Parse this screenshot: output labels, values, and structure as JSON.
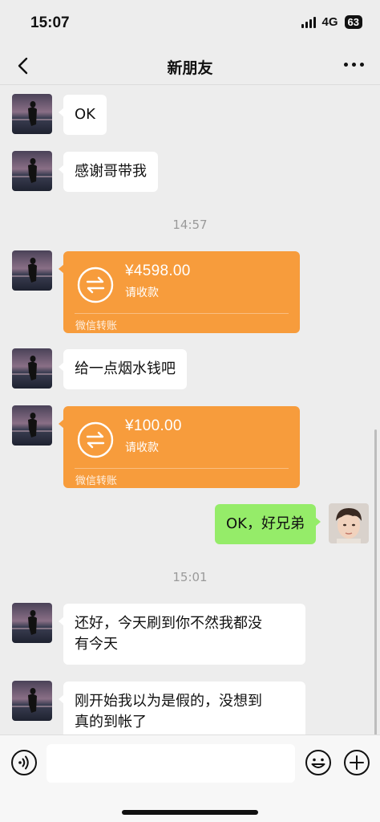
{
  "status_bar": {
    "time": "15:07",
    "network": "4G",
    "battery": "63"
  },
  "nav": {
    "title": "新朋友",
    "back_icon": "chevron-left-icon",
    "more_icon": "more-icon"
  },
  "messages": [
    {
      "type": "text",
      "side": "left",
      "text": "OK"
    },
    {
      "type": "text",
      "side": "left",
      "text": "感谢哥带我"
    },
    {
      "type": "time",
      "text": "14:57"
    },
    {
      "type": "transfer",
      "side": "left",
      "amount": "¥4598.00",
      "status": "请收款",
      "footer": "微信转账"
    },
    {
      "type": "text",
      "side": "left",
      "text": "给一点烟水钱吧"
    },
    {
      "type": "transfer",
      "side": "left",
      "amount": "¥100.00",
      "status": "请收款",
      "footer": "微信转账"
    },
    {
      "type": "text",
      "side": "right",
      "text": "OK，好兄弟"
    },
    {
      "type": "time",
      "text": "15:01"
    },
    {
      "type": "text",
      "side": "left",
      "lines": [
        "还好，今天刷到你不然我都没",
        "有今天"
      ]
    },
    {
      "type": "text",
      "side": "left",
      "lines": [
        "刚开始我以为是假的，没想到",
        "真的到帐了"
      ]
    }
  ],
  "input_bar": {
    "value": "",
    "icons": [
      "voice-icon",
      "emoji-icon",
      "plus-icon"
    ]
  },
  "colors": {
    "background": "#ededed",
    "bubble_self": "#95ec69",
    "transfer": "#f79c3c"
  }
}
